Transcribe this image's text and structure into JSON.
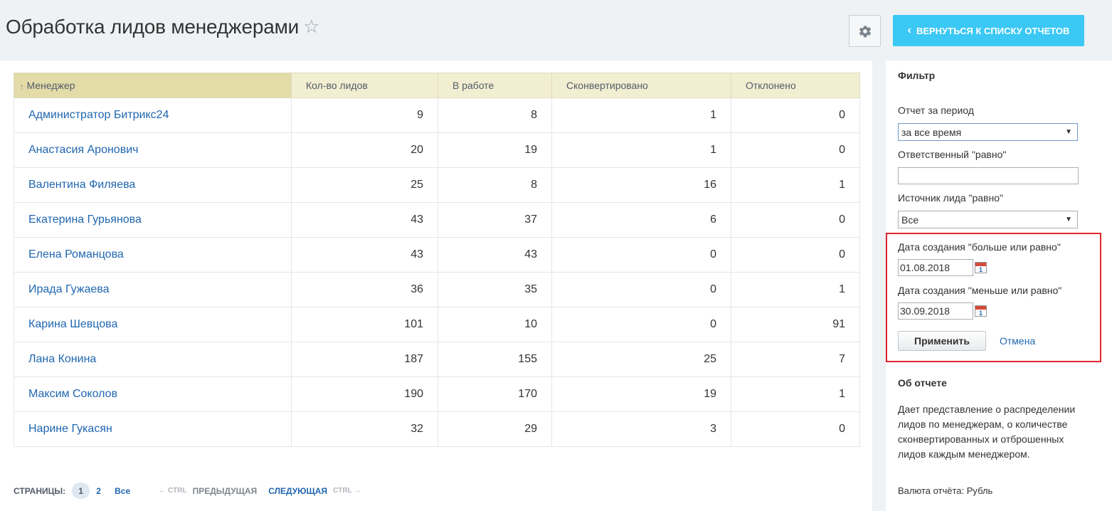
{
  "header": {
    "title": "Обработка лидов менеджерами",
    "star_icon": "star-icon",
    "settings_icon": "gear-icon",
    "back_button_label": "ВЕРНУТЬСЯ К СПИСКУ ОТЧЕТОВ",
    "back_chevron": "‹"
  },
  "table": {
    "sort_arrow": "↑",
    "columns": [
      "Менеджер",
      "Кол-во лидов",
      "В работе",
      "Сконвертировано",
      "Отклонено"
    ],
    "rows": [
      {
        "name": "Администратор Битрикс24",
        "leads": "9",
        "in_work": "8",
        "converted": "1",
        "rejected": "0"
      },
      {
        "name": "Анастасия Аронович",
        "leads": "20",
        "in_work": "19",
        "converted": "1",
        "rejected": "0"
      },
      {
        "name": "Валентина Филяева",
        "leads": "25",
        "in_work": "8",
        "converted": "16",
        "rejected": "1"
      },
      {
        "name": "Екатерина Гурьянова",
        "leads": "43",
        "in_work": "37",
        "converted": "6",
        "rejected": "0"
      },
      {
        "name": "Елена Романцова",
        "leads": "43",
        "in_work": "43",
        "converted": "0",
        "rejected": "0"
      },
      {
        "name": "Ирада Гужаева",
        "leads": "36",
        "in_work": "35",
        "converted": "0",
        "rejected": "1"
      },
      {
        "name": "Карина Шевцова",
        "leads": "101",
        "in_work": "10",
        "converted": "0",
        "rejected": "91"
      },
      {
        "name": "Лана Конина",
        "leads": "187",
        "in_work": "155",
        "converted": "25",
        "rejected": "7"
      },
      {
        "name": "Максим Соколов",
        "leads": "190",
        "in_work": "170",
        "converted": "19",
        "rejected": "1"
      },
      {
        "name": "Нарине Гукасян",
        "leads": "32",
        "in_work": "29",
        "converted": "3",
        "rejected": "0"
      }
    ]
  },
  "pager": {
    "label": "СТРАНИЦЫ:",
    "pages": [
      "1",
      "2"
    ],
    "active_page": "1",
    "all_label": "Все",
    "prev_hint": "← CTRL",
    "prev_label": "ПРЕДЫДУЩАЯ",
    "next_label": "СЛЕДУЮЩАЯ",
    "next_hint": "CTRL →"
  },
  "filter": {
    "title": "Фильтр",
    "period_label": "Отчет за период",
    "period_value": "за все время",
    "responsible_label": "Ответственный \"равно\"",
    "responsible_value": "",
    "source_label": "Источник лида \"равно\"",
    "source_value": "Все",
    "date_from_label": "Дата создания \"больше или равно\"",
    "date_from_value": "01.08.2018",
    "date_to_label": "Дата создания \"меньше или равно\"",
    "date_to_value": "30.09.2018",
    "calendar_day": "1",
    "apply_label": "Применить",
    "cancel_label": "Отмена",
    "highlight_color": "#e0252b"
  },
  "about": {
    "title": "Об отчете",
    "text": "Дает представление о распределении лидов по менеджерам, о количестве сконвертированных и отброшенных лидов каждым менеджером.",
    "currency": "Валюта отчёта: Рубль"
  },
  "colors": {
    "accent": "#3bc8f5",
    "link": "#2067b0",
    "header_bg": "#f2eed1"
  }
}
